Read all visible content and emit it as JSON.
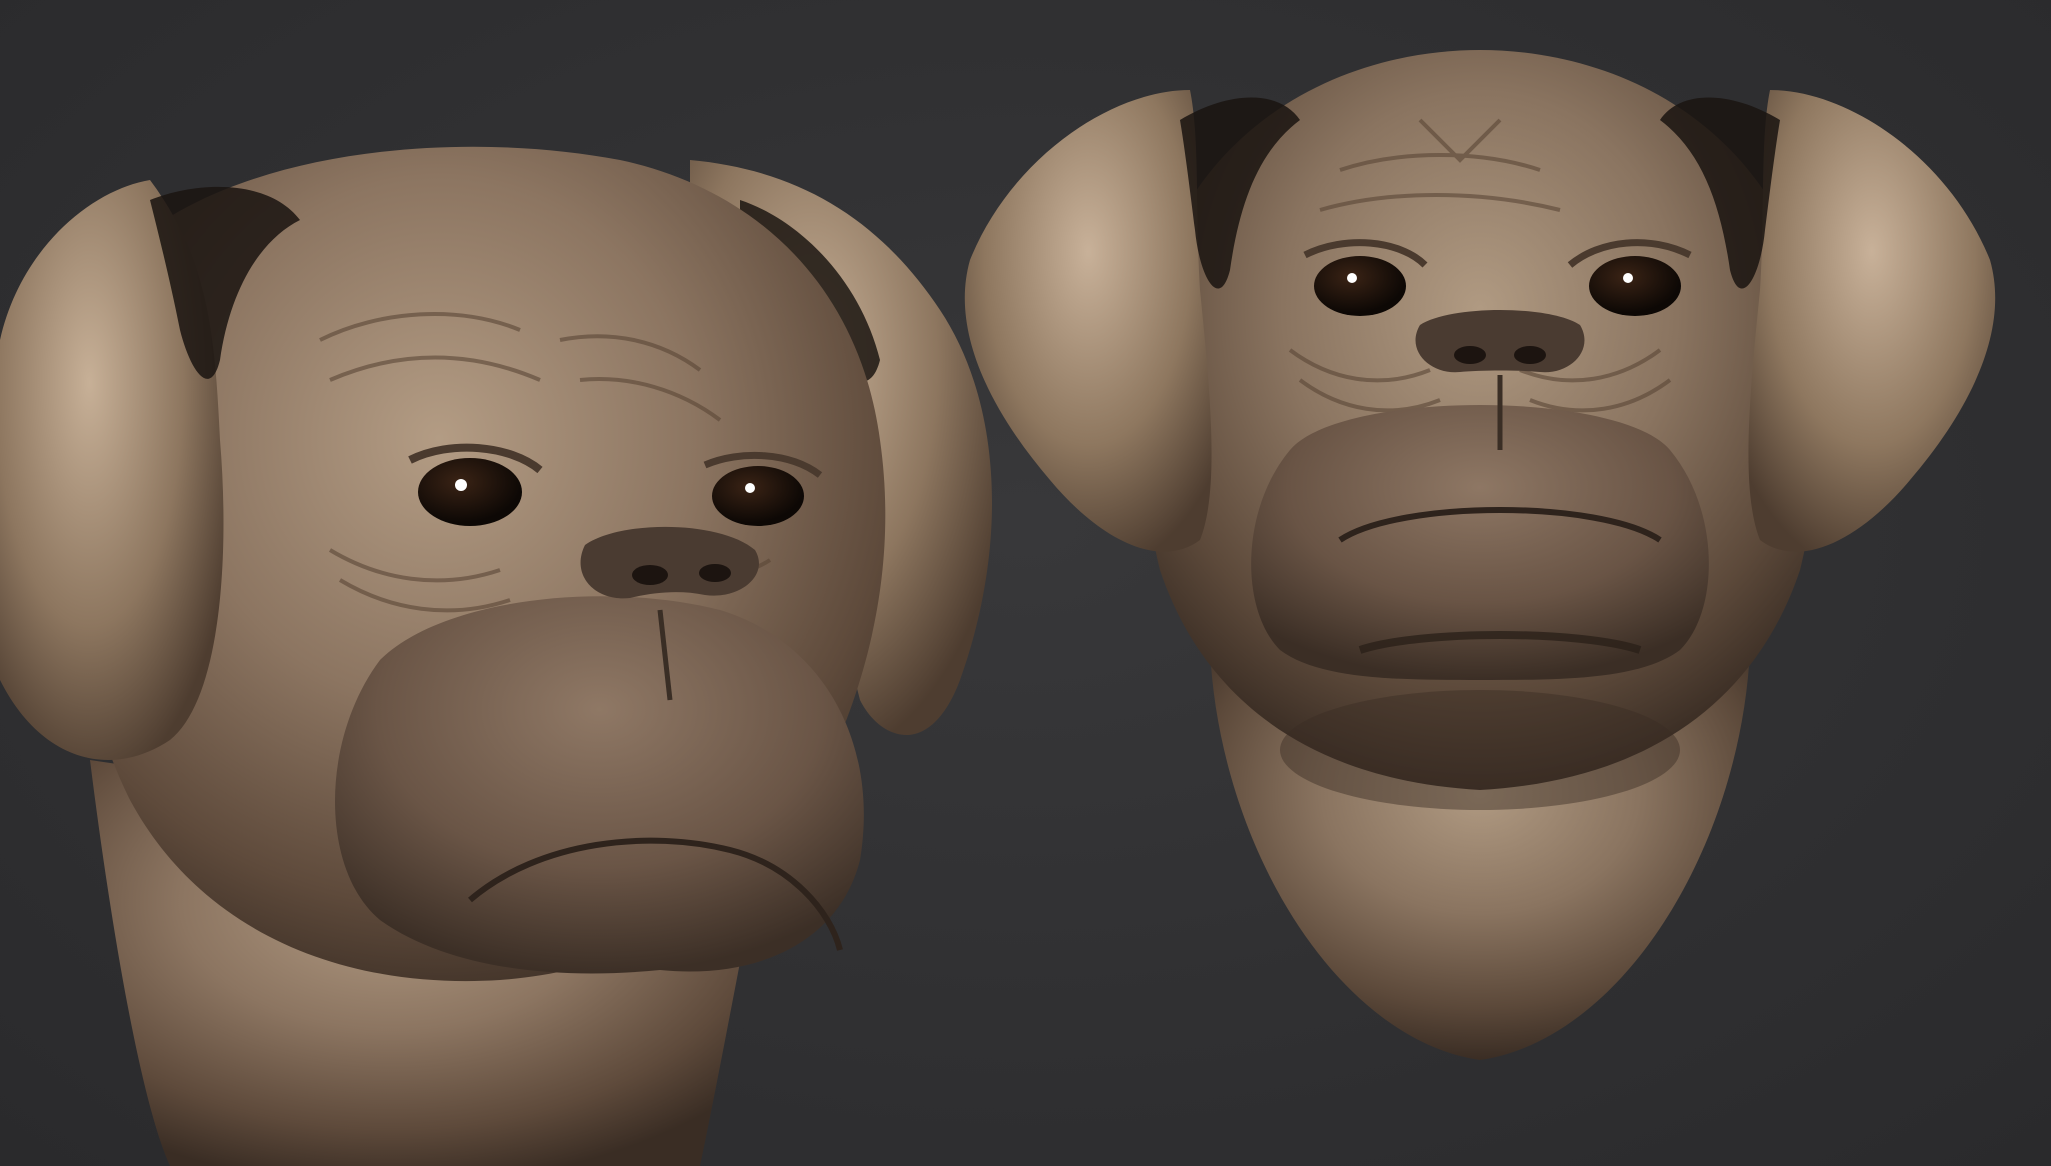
{
  "scene": {
    "background_color": "#2e2e30",
    "material_color": "#8a735f",
    "material_highlight": "#c9b29a",
    "material_shadow": "#3f3127",
    "eye_color": "#1a0f0a",
    "models": [
      {
        "name": "dog-head-three-quarter-view"
      },
      {
        "name": "dog-head-front-view"
      }
    ]
  }
}
